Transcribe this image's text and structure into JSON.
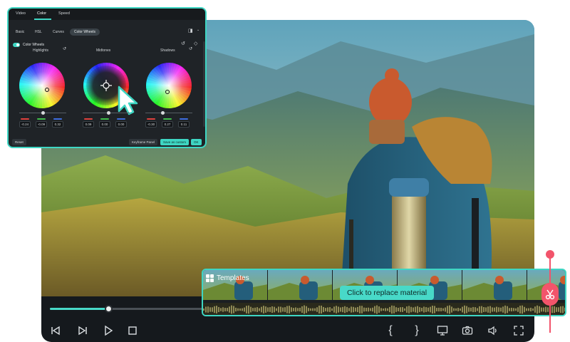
{
  "colors": {
    "accent": "#3ed6c3",
    "panel_bg": "#1f2327",
    "controls_bg": "#15191d",
    "cut_marker": "#f2546b"
  },
  "panel": {
    "top_tabs": [
      "Video",
      "Color",
      "Speed"
    ],
    "active_top_tab": "Color",
    "sub_tabs": [
      "Basic",
      "HSL",
      "Curves",
      "Color Wheels"
    ],
    "active_sub_tab": "Color Wheels",
    "section_title": "Color Wheels",
    "wheels": [
      {
        "label": "Highlights",
        "values": [
          "-0.24",
          "-0.09",
          "0.32"
        ]
      },
      {
        "label": "Midtones",
        "values": [
          "0.09",
          "0.00",
          "0.00"
        ]
      },
      {
        "label": "Shadows",
        "values": [
          "-0.30",
          "0.27",
          "0.11"
        ]
      }
    ],
    "buttons": {
      "reset": "Reset",
      "keyframe": "Keyframe Panel",
      "save_custom": "Save as custom",
      "ok": "OK"
    }
  },
  "templates": {
    "title": "Templates",
    "replace_label": "Click to replace material"
  },
  "playback": {
    "progress_fraction": 0.38
  },
  "icons": {
    "toolbar": [
      "prev-frame-icon",
      "next-frame-icon",
      "play-icon",
      "stop-icon",
      "mark-in-icon",
      "mark-out-icon",
      "display-icon",
      "snapshot-icon",
      "volume-icon",
      "fullscreen-icon"
    ],
    "cut": "scissors-icon",
    "reset": "reset-icon"
  }
}
